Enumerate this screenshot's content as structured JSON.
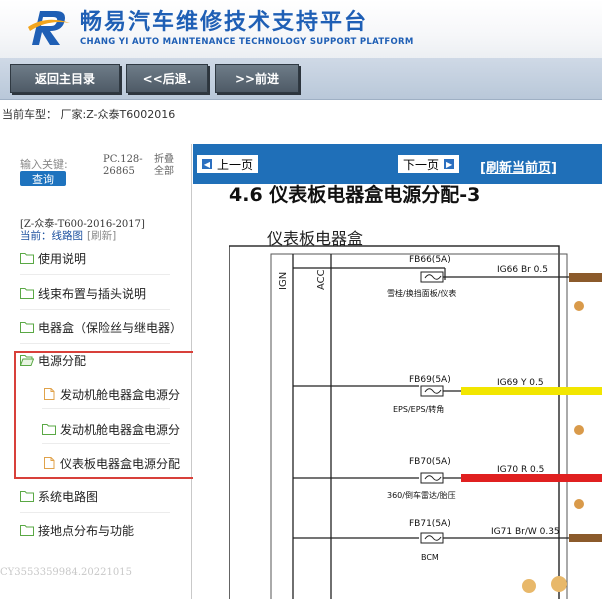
{
  "header": {
    "title": "畅易汽车维修技术支持平台",
    "subtitle": "CHANG YI AUTO MAINTENANCE TECHNOLOGY SUPPORT PLATFORM",
    "brand_color": "#1f5fb5"
  },
  "nav": {
    "home": "返回主目录",
    "back": "<<后退.",
    "forward": ">>前进"
  },
  "vehicle": {
    "label": "当前车型：",
    "value": "厂家:Z-众泰T6002016"
  },
  "sidebar": {
    "search_label": "输入关键:",
    "search_button": "查询",
    "pc_code_line1": "PC.128-",
    "pc_code_line2": "26865",
    "fold_line1": "折叠",
    "fold_line2": "全部",
    "vehicle_name": "[Z-众泰-T600-2016-2017]",
    "current_label": "当前：线路图",
    "refresh": "[刷新]",
    "items": [
      {
        "label": "使用说明",
        "icon": "folder-icon"
      },
      {
        "label": "线束布置与插头说明",
        "icon": "folder-icon"
      },
      {
        "label": "电器盒（保险丝与继电器）",
        "icon": "folder-icon"
      },
      {
        "label": "电源分配",
        "icon": "folder-open-icon"
      },
      {
        "label": "发动机舱电器盒电源分",
        "icon": "document-icon"
      },
      {
        "label": "发动机舱电器盒电源分",
        "icon": "folder-icon"
      },
      {
        "label": "仪表板电器盒电源分配",
        "icon": "document-icon"
      },
      {
        "label": "系统电路图",
        "icon": "folder-icon"
      },
      {
        "label": "接地点分布与功能",
        "icon": "folder-icon"
      }
    ],
    "watermark": "CY3553359984.20221015",
    "highlight_color": "#d8403a"
  },
  "content": {
    "prev_page": "上一页",
    "next_page": "下一页",
    "refresh_page": "[刷新当前页]",
    "doc_title": "4.6 仪表板电器盒电源分配-3",
    "diagram": {
      "box_label": "仪表板电器盒",
      "rails": [
        "IGN",
        "ACC"
      ],
      "fuses": [
        {
          "id": "FB66(5A)",
          "wire": "IG66 Br 0.5",
          "load": "雪桂/换挡面板/仪表",
          "color": "#8b5a2b"
        },
        {
          "id": "FB69(5A)",
          "wire": "IG69 Y 0.5",
          "load": "EPS/EPS/转角",
          "color": "#f2e600"
        },
        {
          "id": "FB70(5A)",
          "wire": "IG70 R 0.5",
          "load": "360/倒车雷达/胎压",
          "color": "#e02020"
        },
        {
          "id": "FB71(5A)",
          "wire": "IG71 Br/W 0.35",
          "load": "BCM",
          "color": "#8b5a2b"
        }
      ]
    }
  }
}
